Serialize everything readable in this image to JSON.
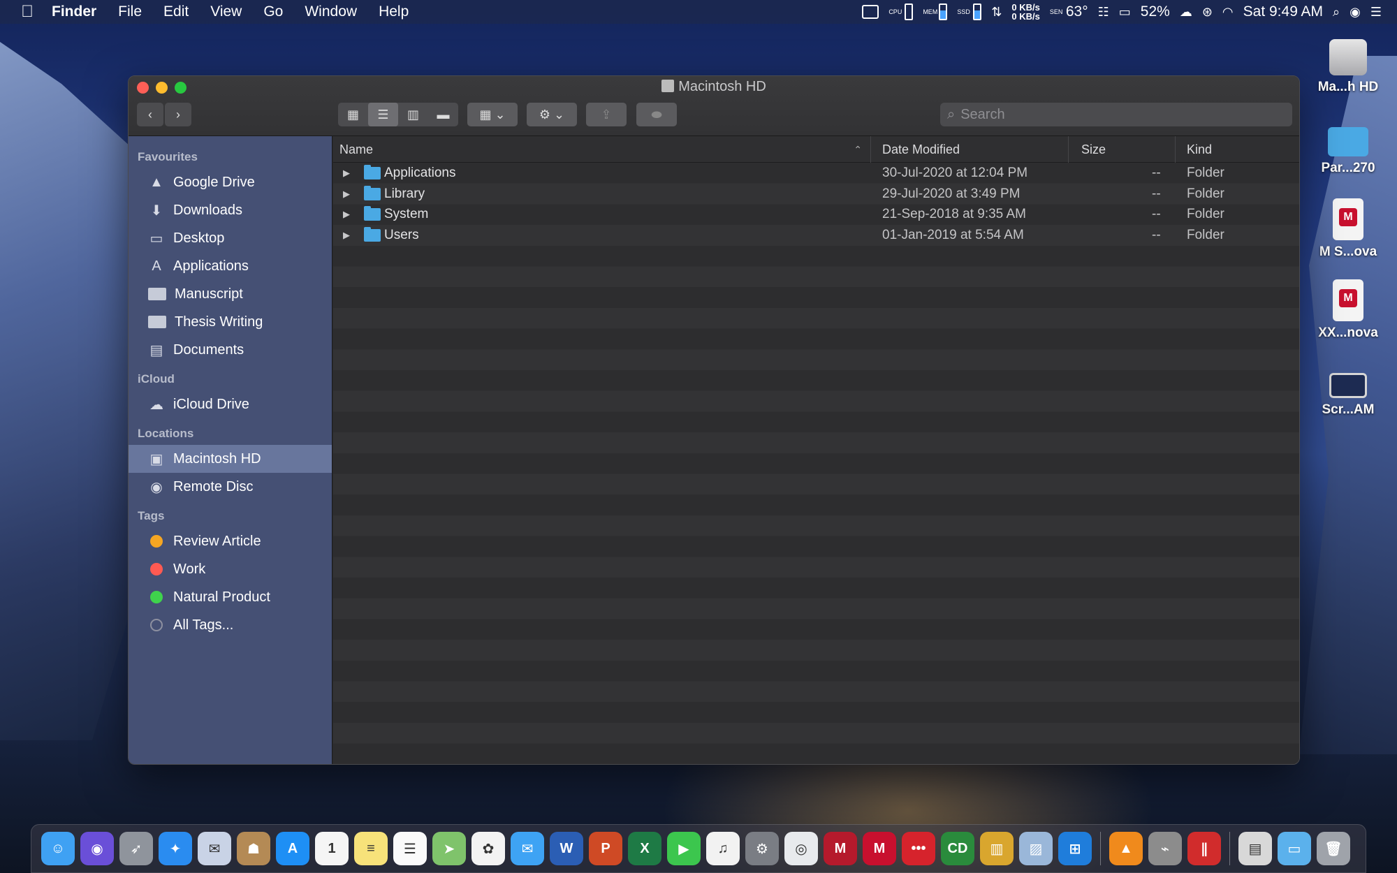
{
  "menubar": {
    "apple": "",
    "items": [
      "Finder",
      "File",
      "Edit",
      "View",
      "Go",
      "Window",
      "Help"
    ],
    "status": {
      "cpu_label": "CPU",
      "mem_label": "MEM",
      "ssd_label": "SSD",
      "net_up": "0 KB/s",
      "net_down": "0 KB/s",
      "temp_label": "SEN",
      "temperature": "63°",
      "battery": "52%",
      "datetime": "Sat 9:49 AM"
    }
  },
  "window": {
    "title": "Macintosh HD",
    "search_placeholder": "Search",
    "nav_back": "‹",
    "nav_forward": "›"
  },
  "sidebar": {
    "sections": [
      {
        "header": "Favourites",
        "items": [
          {
            "label": "Google Drive",
            "icon": "google-drive-icon",
            "glyph": "▲"
          },
          {
            "label": "Downloads",
            "icon": "downloads-icon",
            "glyph": "⬇"
          },
          {
            "label": "Desktop",
            "icon": "desktop-icon",
            "glyph": "▭"
          },
          {
            "label": "Applications",
            "icon": "applications-icon",
            "glyph": "A"
          },
          {
            "label": "Manuscript",
            "icon": "folder-icon",
            "glyph": ""
          },
          {
            "label": "Thesis Writing",
            "icon": "folder-icon",
            "glyph": ""
          },
          {
            "label": "Documents",
            "icon": "documents-icon",
            "glyph": "▤"
          }
        ]
      },
      {
        "header": "iCloud",
        "items": [
          {
            "label": "iCloud Drive",
            "icon": "cloud-icon",
            "glyph": "☁"
          }
        ]
      },
      {
        "header": "Locations",
        "items": [
          {
            "label": "Macintosh HD",
            "icon": "hard-drive-icon",
            "glyph": "▣",
            "selected": true
          },
          {
            "label": "Remote Disc",
            "icon": "disc-icon",
            "glyph": "◉"
          }
        ]
      },
      {
        "header": "Tags",
        "items": [
          {
            "label": "Review Article",
            "icon": "tag-orange-icon",
            "color": "#f5a623"
          },
          {
            "label": "Work",
            "icon": "tag-red-icon",
            "color": "#ff5a52"
          },
          {
            "label": "Natural Product",
            "icon": "tag-green-icon",
            "color": "#3fd34c"
          },
          {
            "label": "All Tags...",
            "icon": "tag-all-icon",
            "color": ""
          }
        ]
      }
    ]
  },
  "columns": {
    "name": "Name",
    "date": "Date Modified",
    "size": "Size",
    "kind": "Kind"
  },
  "files": [
    {
      "name": "Applications",
      "date": "30-Jul-2020 at 12:04 PM",
      "size": "--",
      "kind": "Folder"
    },
    {
      "name": "Library",
      "date": "29-Jul-2020 at 3:49 PM",
      "size": "--",
      "kind": "Folder"
    },
    {
      "name": "System",
      "date": "21-Sep-2018 at 9:35 AM",
      "size": "--",
      "kind": "Folder"
    },
    {
      "name": "Users",
      "date": "01-Jan-2019 at 5:54 AM",
      "size": "--",
      "kind": "Folder"
    }
  ],
  "desktop_icons": [
    {
      "label": "Ma...h HD",
      "icon": "hard-drive-icon",
      "kind": "hd"
    },
    {
      "label": "Par...270",
      "icon": "folder-icon",
      "kind": "folder"
    },
    {
      "label": "M S...ova",
      "icon": "mendeley-document-icon",
      "kind": "doc"
    },
    {
      "label": "XX...nova",
      "icon": "mendeley-document-icon",
      "kind": "doc"
    },
    {
      "label": "Scr...AM",
      "icon": "screenshot-icon",
      "kind": "shot"
    }
  ],
  "dock": [
    {
      "name": "finder-icon",
      "color": "#3fa1f3",
      "glyph": "☺"
    },
    {
      "name": "siri-icon",
      "color": "#6a4fd8",
      "glyph": "◉"
    },
    {
      "name": "launchpad-icon",
      "color": "#8f949c",
      "glyph": "➶"
    },
    {
      "name": "safari-icon",
      "color": "#2a8cf0",
      "glyph": "✦"
    },
    {
      "name": "mail-icon",
      "color": "#c9d3e6",
      "glyph": "✉"
    },
    {
      "name": "contacts-icon",
      "color": "#b48a55",
      "glyph": "☗"
    },
    {
      "name": "app-store-icon",
      "color": "#1e8ff5",
      "glyph": "A"
    },
    {
      "name": "calendar-icon",
      "color": "#f5f5f5",
      "glyph": "1"
    },
    {
      "name": "notes-icon",
      "color": "#f7e27a",
      "glyph": "≡"
    },
    {
      "name": "reminders-icon",
      "color": "#fafafa",
      "glyph": "☰"
    },
    {
      "name": "maps-icon",
      "color": "#7fc36b",
      "glyph": "➤"
    },
    {
      "name": "photos-icon",
      "color": "#f3f3f3",
      "glyph": "✿"
    },
    {
      "name": "messages-icon",
      "color": "#3ea3f4",
      "glyph": "✉"
    },
    {
      "name": "word-icon",
      "color": "#2b5eb4",
      "glyph": "W"
    },
    {
      "name": "powerpoint-icon",
      "color": "#cf4a25",
      "glyph": "P"
    },
    {
      "name": "excel-icon",
      "color": "#1e7a45",
      "glyph": "X"
    },
    {
      "name": "facetime-icon",
      "color": "#3cc64e",
      "glyph": "▶"
    },
    {
      "name": "itunes-icon",
      "color": "#f2f2f2",
      "glyph": "♫"
    },
    {
      "name": "system-preferences-icon",
      "color": "#7a7d84",
      "glyph": "⚙"
    },
    {
      "name": "chrome-icon",
      "color": "#e8eaed",
      "glyph": "◎"
    },
    {
      "name": "mendeley-desktop-icon",
      "color": "#b51a2c",
      "glyph": "M"
    },
    {
      "name": "mendeley-icon",
      "color": "#c8102e",
      "glyph": "M"
    },
    {
      "name": "dots-app-icon",
      "color": "#d6232c",
      "glyph": "•••"
    },
    {
      "name": "cd-app-icon",
      "color": "#2a8b3c",
      "glyph": "CD"
    },
    {
      "name": "archive-utility-icon",
      "color": "#d9a62e",
      "glyph": "▥"
    },
    {
      "name": "preview-icon",
      "color": "#9ab7d9",
      "glyph": "▨"
    },
    {
      "name": "windows-icon",
      "color": "#1f7ddb",
      "glyph": "⊞"
    },
    {
      "name": "vlc-icon",
      "color": "#f08a1c",
      "glyph": "▲"
    },
    {
      "name": "directory-utility-icon",
      "color": "#8c8c8c",
      "glyph": "⌁"
    },
    {
      "name": "parallels-icon",
      "color": "#d12c2c",
      "glyph": "∥"
    },
    {
      "name": "documents-stack-icon",
      "color": "#d8d8d8",
      "glyph": "▤"
    },
    {
      "name": "downloads-stack-icon",
      "color": "#5bb1ec",
      "glyph": "▭"
    },
    {
      "name": "trash-icon",
      "color": "#9fa3aa",
      "glyph": "🗑"
    }
  ]
}
